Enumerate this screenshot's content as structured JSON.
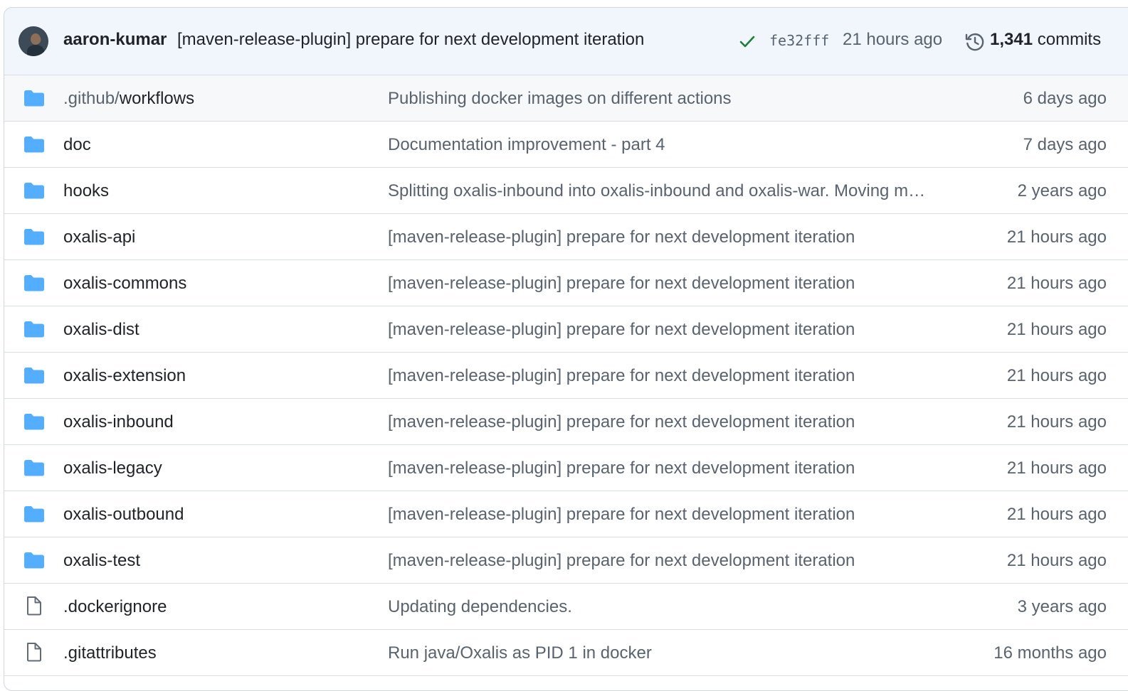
{
  "header": {
    "author": "aaron-kumar",
    "message": "[maven-release-plugin] prepare for next development iteration",
    "sha": "fe32fff",
    "time": "21 hours ago",
    "commits_count": "1,341",
    "commits_label": "commits",
    "status": "success",
    "status_color": "#1a7f37"
  },
  "colors": {
    "folder": "#54aeff",
    "file": "#636c76"
  },
  "files": [
    {
      "type": "folder",
      "name_dim": ".github/",
      "name": "workflows",
      "message": "Publishing docker images on different actions",
      "age": "6 days ago"
    },
    {
      "type": "folder",
      "name_dim": "",
      "name": "doc",
      "message": "Documentation improvement - part 4",
      "age": "7 days ago"
    },
    {
      "type": "folder",
      "name_dim": "",
      "name": "hooks",
      "message": "Splitting oxalis-inbound into oxalis-inbound and oxalis-war. Moving m…",
      "age": "2 years ago"
    },
    {
      "type": "folder",
      "name_dim": "",
      "name": "oxalis-api",
      "message": "[maven-release-plugin] prepare for next development iteration",
      "age": "21 hours ago"
    },
    {
      "type": "folder",
      "name_dim": "",
      "name": "oxalis-commons",
      "message": "[maven-release-plugin] prepare for next development iteration",
      "age": "21 hours ago"
    },
    {
      "type": "folder",
      "name_dim": "",
      "name": "oxalis-dist",
      "message": "[maven-release-plugin] prepare for next development iteration",
      "age": "21 hours ago"
    },
    {
      "type": "folder",
      "name_dim": "",
      "name": "oxalis-extension",
      "message": "[maven-release-plugin] prepare for next development iteration",
      "age": "21 hours ago"
    },
    {
      "type": "folder",
      "name_dim": "",
      "name": "oxalis-inbound",
      "message": "[maven-release-plugin] prepare for next development iteration",
      "age": "21 hours ago"
    },
    {
      "type": "folder",
      "name_dim": "",
      "name": "oxalis-legacy",
      "message": "[maven-release-plugin] prepare for next development iteration",
      "age": "21 hours ago"
    },
    {
      "type": "folder",
      "name_dim": "",
      "name": "oxalis-outbound",
      "message": "[maven-release-plugin] prepare for next development iteration",
      "age": "21 hours ago"
    },
    {
      "type": "folder",
      "name_dim": "",
      "name": "oxalis-test",
      "message": "[maven-release-plugin] prepare for next development iteration",
      "age": "21 hours ago"
    },
    {
      "type": "file",
      "name_dim": "",
      "name": ".dockerignore",
      "message": "Updating dependencies.",
      "age": "3 years ago"
    },
    {
      "type": "file",
      "name_dim": "",
      "name": ".gitattributes",
      "message": "Run java/Oxalis as PID 1 in docker",
      "age": "16 months ago"
    }
  ]
}
